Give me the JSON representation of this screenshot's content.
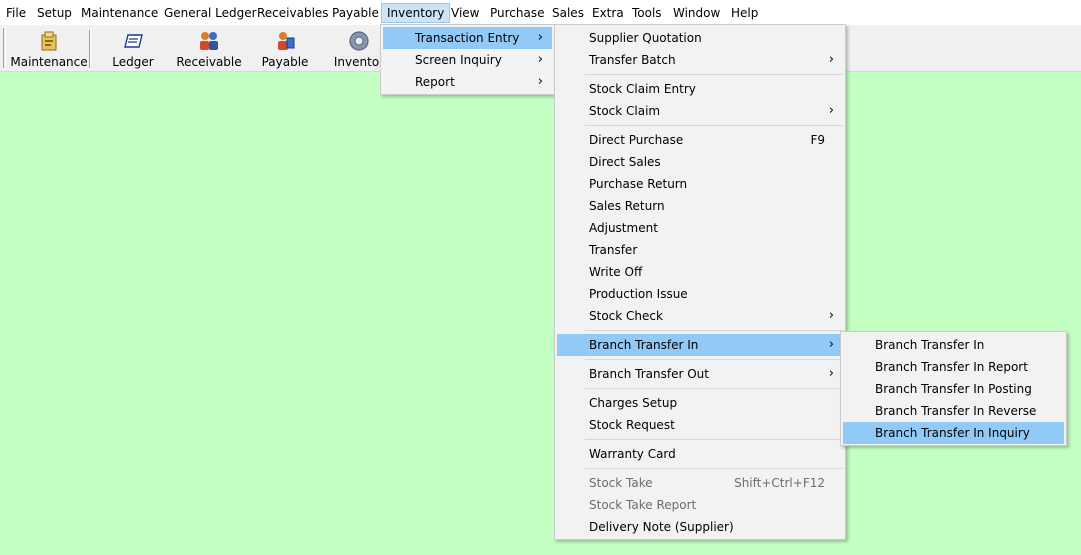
{
  "menubar": [
    "File",
    "Setup",
    "Maintenance",
    "General Ledger",
    "Receivables",
    "Payable",
    "Inventory",
    "View",
    "Purchase",
    "Sales",
    "Extra",
    "Tools",
    "Window",
    "Help"
  ],
  "toolbar": {
    "maintenance": "Maintenance",
    "ledger": "Ledger",
    "receivable": "Receivable",
    "payable": "Payable",
    "inventory": "Inventor"
  },
  "inventory_menu": [
    "Transaction Entry",
    "Screen Inquiry",
    "Report"
  ],
  "transaction_menu": {
    "items": [
      "Supplier Quotation",
      "Transfer Batch",
      "Stock Claim Entry",
      "Stock Claim",
      "Direct Purchase",
      "Direct Sales",
      "Purchase Return",
      "Sales Return",
      "Adjustment",
      "Transfer",
      "Write Off",
      "Production Issue",
      "Stock Check",
      "Branch Transfer In",
      "Branch Transfer Out",
      "Charges Setup",
      "Stock Request",
      "Warranty Card",
      "Stock Take",
      "Stock Take Report",
      "Delivery Note (Supplier)"
    ],
    "shortcut_f9": "F9",
    "shortcut_stocktake": "Shift+Ctrl+F12"
  },
  "branch_in_menu": [
    "Branch Transfer In",
    "Branch Transfer In Report",
    "Branch Transfer In Posting",
    "Branch Transfer In Reverse",
    "Branch Transfer In Inquiry"
  ],
  "arrow": "›",
  "colors": {
    "background": "#c4ffc4",
    "highlight": "#91c9f7",
    "menubar_open": "#cce4f7"
  }
}
